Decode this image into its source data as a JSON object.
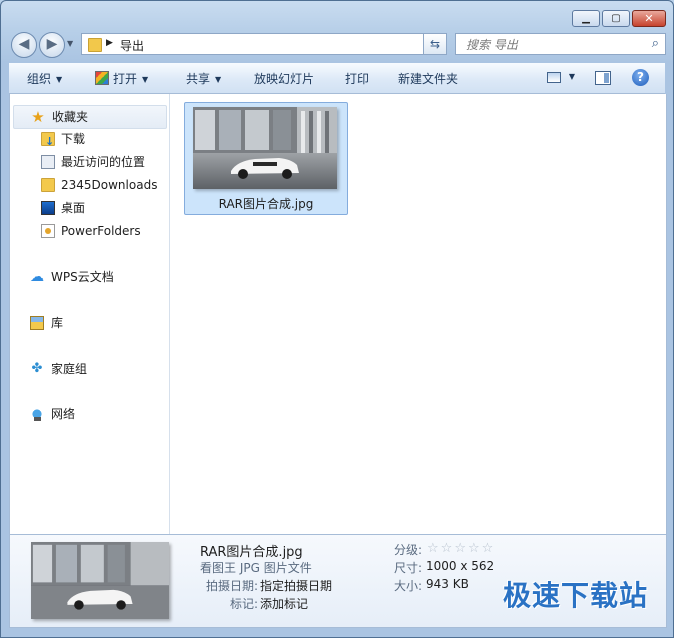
{
  "navigation": {
    "back": "back",
    "forward": "forward"
  },
  "address": {
    "path": "导出"
  },
  "search": {
    "placeholder": "搜索 导出"
  },
  "toolbar": {
    "organize": "组织",
    "open": "打开",
    "share": "共享",
    "slideshow": "放映幻灯片",
    "print": "打印",
    "new_folder": "新建文件夹"
  },
  "sidebar": {
    "favorites": {
      "label": "收藏夹",
      "items": [
        {
          "label": "下载",
          "icon": "download-folder-icon"
        },
        {
          "label": "最近访问的位置",
          "icon": "recent-places-icon"
        },
        {
          "label": "2345Downloads",
          "icon": "folder-icon"
        },
        {
          "label": "桌面",
          "icon": "desktop-icon"
        },
        {
          "label": "PowerFolders",
          "icon": "powerfolders-icon"
        }
      ]
    },
    "groups": [
      {
        "label": "WPS云文档",
        "icon": "cloud-icon"
      },
      {
        "label": "库",
        "icon": "library-icon"
      },
      {
        "label": "家庭组",
        "icon": "homegroup-icon"
      },
      {
        "label": "网络",
        "icon": "network-icon"
      }
    ]
  },
  "files": [
    {
      "name": "RAR图片合成.jpg"
    }
  ],
  "details": {
    "name": "RAR图片合成.jpg",
    "type": "看图王 JPG 图片文件",
    "date_key": "拍摄日期:",
    "date_value": "指定拍摄日期",
    "tags_key": "标记:",
    "tags_value": "添加标记",
    "rating_key": "分级:",
    "rating": 0,
    "rating_max": 5,
    "size_key": "尺寸:",
    "size_value": "1000 x 562",
    "filesize_key": "大小:",
    "filesize_value": "943 KB"
  },
  "watermark": "极速下载站",
  "colors": {
    "accent": "#2a72c4",
    "selection": "#cce4fb",
    "chrome": "#b9d1ea"
  }
}
